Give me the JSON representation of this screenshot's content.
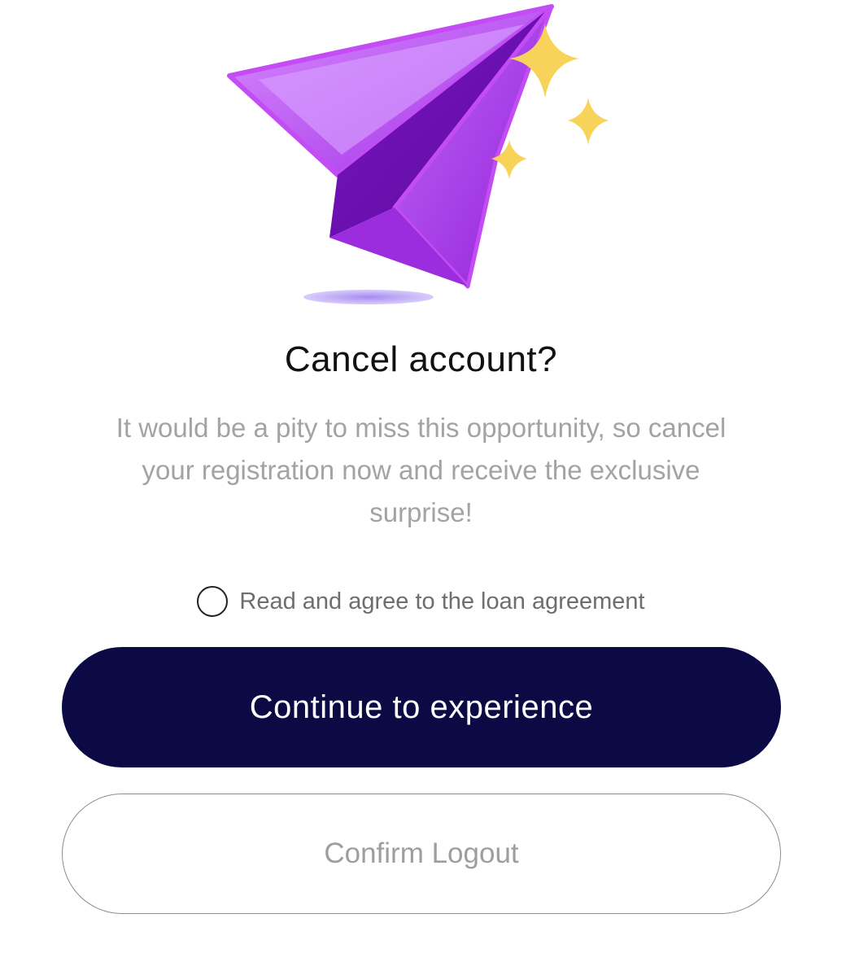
{
  "dialog": {
    "title": "Cancel account?",
    "message": "It would be a pity to miss this opportunity, so cancel your registration now and receive the exclusive surprise!",
    "agreement_label": "Read and agree to the loan agreement",
    "agreement_checked": false,
    "continue_label": "Continue to experience",
    "logout_label": "Confirm Logout"
  },
  "colors": {
    "primary_button": "#0b0a45",
    "plane": "#b44cf0",
    "sparkle": "#f7d35a",
    "message_text": "#a3a3a3"
  },
  "icons": {
    "illustration": "paper-plane-with-sparkles",
    "agreement": "radio-circle-icon"
  }
}
